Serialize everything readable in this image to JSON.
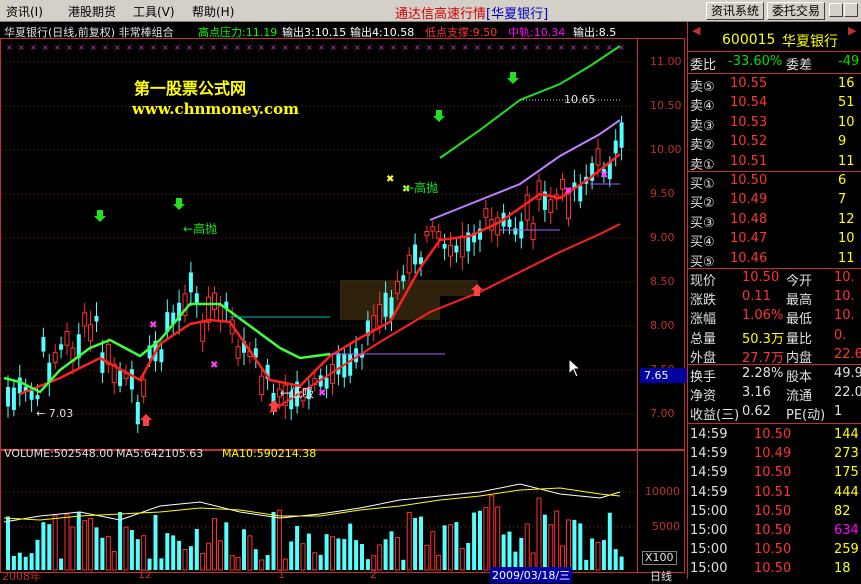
{
  "menubar": {
    "items": [
      "资讯(I)",
      "港股期货",
      "工具(V)",
      "帮助(H)"
    ],
    "title": "通达信高速行情",
    "stock_in_title": "[华夏银行]",
    "buttons": [
      "资讯系统",
      "委托交易"
    ]
  },
  "chart": {
    "header_name": "华夏银行(日线,前复权) 非常棒组合",
    "header_indicators": [
      {
        "text": "高点压力:11.19",
        "color": "#00ff00"
      },
      {
        "text": "输出3:10.15",
        "color": "#ffffff"
      },
      {
        "text": "输出4:10.58",
        "color": "#ffffff"
      },
      {
        "text": "低点支撑:9.50",
        "color": "#ff3232"
      },
      {
        "text": "中轨:10.34",
        "color": "#ff00ff"
      },
      {
        "text": "输出:8.5",
        "color": "#ffffff"
      }
    ],
    "watermark_cn": "第一股票公式网",
    "watermark_url": "www.chnmoney.com",
    "price_axis": [
      "11.00",
      "10.50",
      "10.00",
      "9.50",
      "9.00",
      "8.50",
      "8.00",
      "7.50",
      "7.00"
    ],
    "current_price_tag": "7.65",
    "annotations": {
      "high_label_1": "高抛",
      "high_label_2": "高抛",
      "low_label": "低吸",
      "min_price": "7.03",
      "max_price": "10.65"
    },
    "volume_header": {
      "vol": "VOLUME:502548.00",
      "ma5": "MA5:642105.63",
      "ma10": "MA10:590214.38"
    },
    "volume_axis": [
      "10000",
      "5000"
    ],
    "volume_unit": "X100",
    "bottom_axis": [
      "2008年",
      "12",
      "1",
      "2",
      "2009/03/18/三"
    ],
    "period": "日线"
  },
  "quote": {
    "code": "600015",
    "name": "华夏银行",
    "ratio_label": "委比",
    "ratio_value": "-33.60%",
    "diff_label": "委差",
    "diff_value": "-49",
    "asks": [
      {
        "label": "卖⑤",
        "price": "10.55",
        "vol": "16"
      },
      {
        "label": "卖④",
        "price": "10.54",
        "vol": "51"
      },
      {
        "label": "卖③",
        "price": "10.53",
        "vol": "10"
      },
      {
        "label": "卖②",
        "price": "10.52",
        "vol": "9"
      },
      {
        "label": "卖①",
        "price": "10.51",
        "vol": "11"
      }
    ],
    "bids": [
      {
        "label": "买①",
        "price": "10.50",
        "vol": "6"
      },
      {
        "label": "买②",
        "price": "10.49",
        "vol": "7"
      },
      {
        "label": "买③",
        "price": "10.48",
        "vol": "12"
      },
      {
        "label": "买④",
        "price": "10.47",
        "vol": "10"
      },
      {
        "label": "买⑤",
        "price": "10.46",
        "vol": "11"
      }
    ],
    "stats": [
      {
        "l1": "现价",
        "v1": "10.50",
        "l2": "今开",
        "v2": "10."
      },
      {
        "l1": "涨跌",
        "v1": "0.11",
        "l2": "最高",
        "v2": "10."
      },
      {
        "l1": "涨幅",
        "v1": "1.06%",
        "l2": "最低",
        "v2": "10."
      },
      {
        "l1": "总量",
        "v1": "50.3万",
        "l2": "量比",
        "v2": "0."
      },
      {
        "l1": "外盘",
        "v1": "27.7万",
        "l2": "内盘",
        "v2": "22.6"
      }
    ],
    "fin": [
      {
        "l1": "换手",
        "v1": "2.28%",
        "l2": "股本",
        "v2": "49.9"
      },
      {
        "l1": "净资",
        "v1": "3.16",
        "l2": "流通",
        "v2": "22.0"
      },
      {
        "l1": "收益(三)",
        "v1": "0.62",
        "l2": "PE(动)",
        "v2": "1"
      }
    ],
    "ticks": [
      {
        "time": "14:59",
        "price": "10.50",
        "vol": "144"
      },
      {
        "time": "14:59",
        "price": "10.49",
        "vol": "273"
      },
      {
        "time": "14:59",
        "price": "10.50",
        "vol": "175"
      },
      {
        "time": "14:59",
        "price": "10.51",
        "vol": "444"
      },
      {
        "time": "15:00",
        "price": "10.50",
        "vol": "82"
      },
      {
        "time": "15:00",
        "price": "10.50",
        "vol": "634"
      },
      {
        "time": "15:00",
        "price": "10.50",
        "vol": "259"
      },
      {
        "time": "15:00",
        "price": "10.50",
        "vol": "18"
      }
    ]
  }
}
